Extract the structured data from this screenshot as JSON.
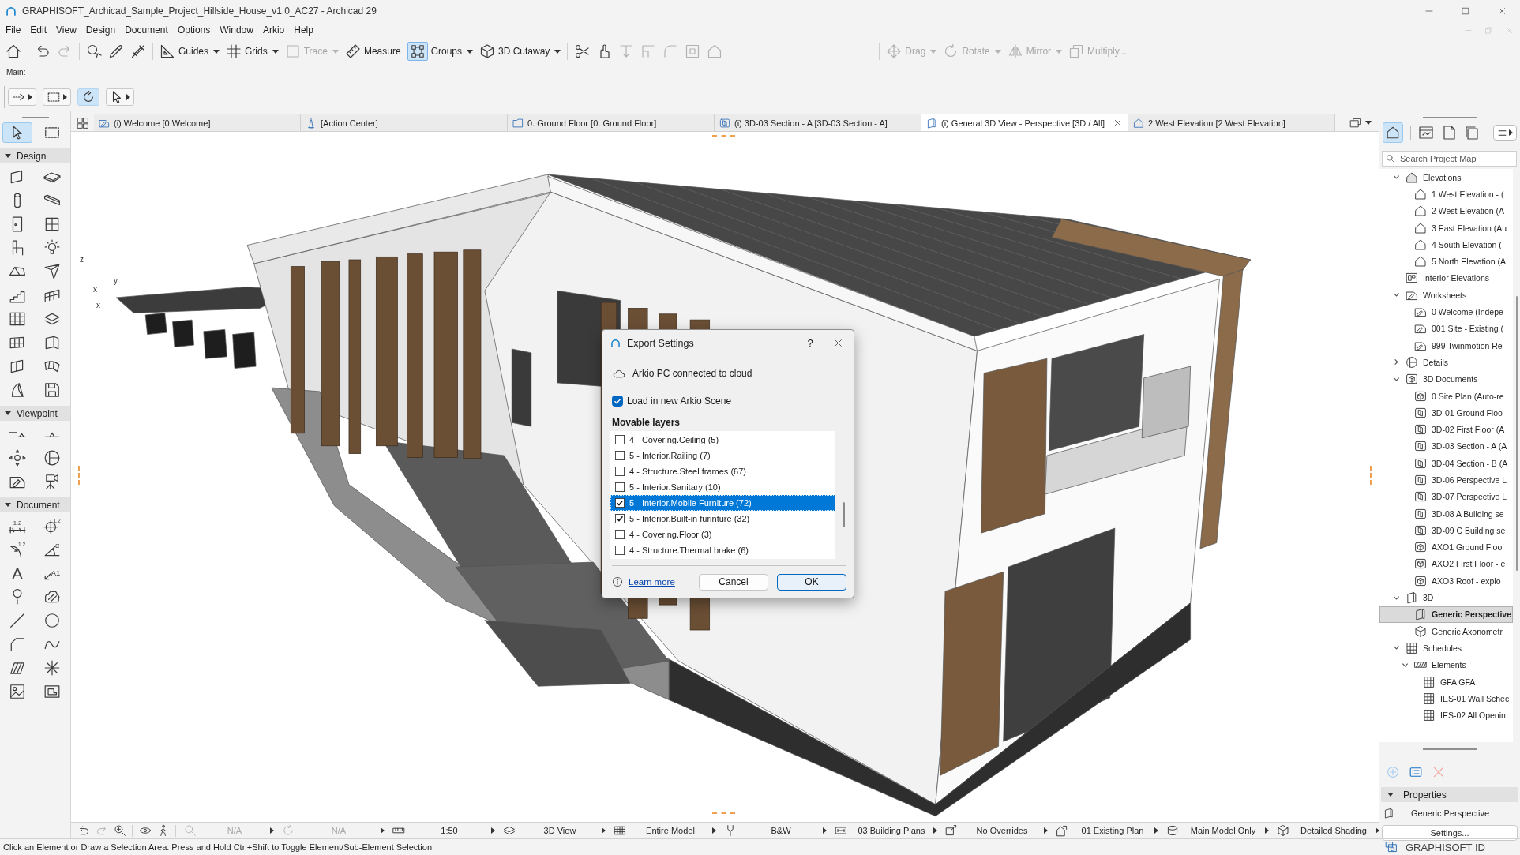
{
  "window": {
    "title": "GRAPHISOFT_Archicad_Sample_Project_Hillside_House_v1.0_AC27 - Archicad 29"
  },
  "menu_bar": {
    "items": [
      "File",
      "Edit",
      "View",
      "Design",
      "Document",
      "Options",
      "Window",
      "Arkio",
      "Help"
    ]
  },
  "toolbar": {
    "left": [
      [
        {
          "kind": "home",
          "disabled": false
        }
      ],
      [
        {
          "kind": "undo",
          "disabled": false
        },
        {
          "kind": "redo",
          "disabled": true
        }
      ],
      [
        {
          "kind": "find",
          "disabled": false
        },
        {
          "kind": "pick_up",
          "disabled": false
        },
        {
          "kind": "inject",
          "disabled": false
        }
      ],
      [
        {
          "kind": "guides",
          "label": "Guides",
          "disabled": false,
          "on": false,
          "menu": true
        },
        {
          "kind": "grids",
          "label": "Grids",
          "disabled": false,
          "on": false,
          "menu": true
        },
        {
          "kind": "trace",
          "label": "Trace",
          "disabled": true,
          "on": false,
          "menu": true
        },
        {
          "kind": "measure",
          "label": "Measure",
          "disabled": false,
          "on": false,
          "menu": false
        },
        {
          "kind": "groups",
          "label": "Groups",
          "disabled": false,
          "on": true,
          "menu": true
        },
        {
          "kind": "cutaway",
          "label": "3D Cutaway",
          "disabled": false,
          "on": false,
          "menu": true
        }
      ],
      [
        {
          "kind": "split",
          "disabled": false
        },
        {
          "kind": "adjust",
          "disabled": false
        },
        {
          "kind": "trim",
          "disabled": true
        },
        {
          "kind": "intersect",
          "disabled": true
        },
        {
          "kind": "fillet",
          "disabled": true
        },
        {
          "kind": "offset",
          "disabled": true
        },
        {
          "kind": "solid",
          "disabled": true
        }
      ]
    ],
    "right": [
      {
        "kind": "drag",
        "label": "Drag",
        "disabled": true,
        "on": false,
        "menu": true
      },
      {
        "kind": "rotate",
        "label": "Rotate",
        "disabled": true,
        "on": false,
        "menu": true
      },
      {
        "kind": "mirror",
        "label": "Mirror",
        "disabled": true,
        "on": false,
        "menu": true
      },
      {
        "kind": "multiply",
        "label": "Multiply...",
        "disabled": true,
        "on": false,
        "menu": false
      }
    ]
  },
  "info_box": {
    "label": "Main:",
    "tools": [
      {
        "kind": "dim_type",
        "selected": false,
        "menu": true
      },
      {
        "kind": "marquee",
        "selected": false,
        "menu": true
      },
      {
        "kind": "orbit",
        "selected": true,
        "menu": false
      },
      {
        "kind": "pointer",
        "selected": false,
        "menu": true
      }
    ]
  },
  "toolbox": {
    "pointer_tools": [
      {
        "kind": "pointer",
        "selected": true
      },
      {
        "kind": "marquee",
        "selected": false
      }
    ],
    "sections": [
      {
        "title": "Design",
        "expanded": true,
        "tools": [
          {
            "kind": "wall",
            "selected": false
          },
          {
            "kind": "slab",
            "selected": false
          },
          {
            "kind": "column",
            "selected": false
          },
          {
            "kind": "beam",
            "selected": false
          },
          {
            "kind": "door",
            "selected": false
          },
          {
            "kind": "window",
            "selected": false
          },
          {
            "kind": "object",
            "selected": false
          },
          {
            "kind": "lamp",
            "selected": false
          },
          {
            "kind": "roof",
            "selected": false
          },
          {
            "kind": "shell",
            "selected": false
          },
          {
            "kind": "stair",
            "selected": false
          },
          {
            "kind": "railing",
            "selected": false
          },
          {
            "kind": "curtain_wall",
            "selected": false
          },
          {
            "kind": "stacked",
            "selected": false
          },
          {
            "kind": "zone",
            "selected": false
          },
          {
            "kind": "corner_panel",
            "selected": false
          },
          {
            "kind": "skylight",
            "selected": false
          },
          {
            "kind": "mesh",
            "selected": false
          },
          {
            "kind": "morph",
            "selected": false
          },
          {
            "kind": "object_box",
            "selected": false
          }
        ]
      },
      {
        "title": "Viewpoint",
        "expanded": true,
        "tools": [
          {
            "kind": "section",
            "selected": false
          },
          {
            "kind": "elevation_marker",
            "selected": false
          },
          {
            "kind": "interior_elevation",
            "selected": false
          },
          {
            "kind": "detail",
            "selected": false
          },
          {
            "kind": "worksheet",
            "selected": false
          },
          {
            "kind": "camera",
            "selected": false
          }
        ]
      },
      {
        "title": "Document",
        "expanded": true,
        "tools": [
          {
            "kind": "dimension",
            "glyph": "1.2",
            "selected": false
          },
          {
            "kind": "level_dimension",
            "glyph": "1.2",
            "selected": false
          },
          {
            "kind": "radial_dimension",
            "glyph": "1.2",
            "selected": false
          },
          {
            "kind": "angle_dimension",
            "glyph": "α",
            "selected": false
          },
          {
            "kind": "text",
            "glyph": "A",
            "selected": false
          },
          {
            "kind": "label",
            "glyph": "A1",
            "selected": false
          },
          {
            "kind": "marker",
            "selected": false
          },
          {
            "kind": "revision",
            "selected": false
          },
          {
            "kind": "line",
            "selected": false
          },
          {
            "kind": "circle",
            "selected": false
          },
          {
            "kind": "polyline",
            "selected": false
          },
          {
            "kind": "spline",
            "selected": false
          },
          {
            "kind": "fill",
            "selected": false
          },
          {
            "kind": "hotspot",
            "selected": false
          },
          {
            "kind": "figure",
            "selected": false
          },
          {
            "kind": "drawing",
            "selected": false
          }
        ]
      }
    ]
  },
  "tabs": {
    "items": [
      {
        "kind": "worksheet",
        "label": "(i) Welcome [0 Welcome]",
        "selected": false
      },
      {
        "kind": "action_center",
        "label": "[Action Center]",
        "selected": false
      },
      {
        "kind": "floor_plan",
        "label": "0. Ground Floor [0. Ground Floor]",
        "selected": false
      },
      {
        "kind": "section_3d",
        "label": "(i) 3D-03 Section - A [3D-03 Section - A]",
        "selected": false
      },
      {
        "kind": "perspective",
        "label": "(i) General 3D View - Perspective [3D / All]",
        "selected": true
      },
      {
        "kind": "elevation",
        "label": "2 West Elevation [2 West Elevation]",
        "selected": false
      }
    ]
  },
  "viewport": {
    "axis_labels": [
      "z",
      "x",
      "y",
      "x"
    ]
  },
  "dialog": {
    "title": "Export Settings",
    "help": "?",
    "connection": "Arkio PC connected to cloud",
    "load_scene": {
      "label": "Load in new Arkio Scene",
      "checked": true
    },
    "layers_heading": "Movable layers",
    "layers": [
      {
        "name": "4 - Covering.Ceiling (5)",
        "checked": false,
        "selected": false
      },
      {
        "name": "5 - Interior.Railing (7)",
        "checked": false,
        "selected": false
      },
      {
        "name": "4 - Structure.Steel frames (67)",
        "checked": false,
        "selected": false
      },
      {
        "name": "5 - Interior.Sanitary (10)",
        "checked": false,
        "selected": false
      },
      {
        "name": "5 - Interior.Mobile Furniture (72)",
        "checked": true,
        "selected": true
      },
      {
        "name": "5 - Interior.Built-in furinture (32)",
        "checked": true,
        "selected": false
      },
      {
        "name": "4 - Covering.Floor (3)",
        "checked": false,
        "selected": false
      },
      {
        "name": "4 - Structure.Thermal brake (6)",
        "checked": false,
        "selected": false
      }
    ],
    "link": "Learn more",
    "buttons": [
      {
        "label": "Cancel",
        "default": false
      },
      {
        "label": "OK",
        "default": true
      }
    ]
  },
  "navigator": {
    "views": [
      {
        "kind": "project_map",
        "selected": true
      },
      {
        "kind": "view_map",
        "selected": false
      },
      {
        "kind": "layout_book",
        "selected": false
      },
      {
        "kind": "publisher",
        "selected": false
      }
    ],
    "search": {
      "placeholder": "Search Project Map"
    },
    "tree": [
      {
        "kind": "elevations",
        "label": "Elevations",
        "expanded": true,
        "selected": false,
        "children": [
          {
            "kind": "elevation",
            "label": "1 West Elevation - (",
            "selected": false
          },
          {
            "kind": "elevation",
            "label": "2 West Elevation (A",
            "selected": false
          },
          {
            "kind": "elevation",
            "label": "3 East Elevation (Au",
            "selected": false
          },
          {
            "kind": "elevation",
            "label": "4 South Elevation (",
            "selected": false
          },
          {
            "kind": "elevation",
            "label": "5 North Elevation (A",
            "selected": false
          }
        ]
      },
      {
        "kind": "interior_elevations",
        "label": "Interior Elevations",
        "selected": false
      },
      {
        "kind": "worksheet",
        "label": "Worksheets",
        "expanded": true,
        "selected": false,
        "children": [
          {
            "kind": "worksheet",
            "label": "0 Welcome (Indepe",
            "selected": false
          },
          {
            "kind": "worksheet",
            "label": "001 Site - Existing (",
            "selected": false
          },
          {
            "kind": "worksheet",
            "label": "999 Twinmotion Re",
            "selected": false
          }
        ]
      },
      {
        "kind": "detail",
        "label": "Details",
        "expanded": false,
        "selected": false
      },
      {
        "kind": "documents_3d",
        "label": "3D Documents",
        "expanded": true,
        "selected": false,
        "children": [
          {
            "kind": "documents_3d",
            "label": "0 Site Plan (Auto-re",
            "selected": false
          },
          {
            "kind": "section_doc",
            "label": "3D-01 Ground Floo",
            "selected": false
          },
          {
            "kind": "section_doc",
            "label": "3D-02 First Floor (A",
            "selected": false
          },
          {
            "kind": "section_doc",
            "label": "3D-03 Section - A (A",
            "selected": false
          },
          {
            "kind": "section_doc",
            "label": "3D-04 Section - B (A",
            "selected": false
          },
          {
            "kind": "section_doc",
            "label": "3D-06 Perspective L",
            "selected": false
          },
          {
            "kind": "section_doc",
            "label": "3D-07 Perspective L",
            "selected": false
          },
          {
            "kind": "section_doc",
            "label": "3D-08 A Building se",
            "selected": false
          },
          {
            "kind": "section_doc",
            "label": "3D-09 C Building se",
            "selected": false
          },
          {
            "kind": "documents_3d",
            "label": "AXO1 Ground Floo",
            "selected": false
          },
          {
            "kind": "documents_3d",
            "label": "AXO2 First Floor - e",
            "selected": false
          },
          {
            "kind": "documents_3d",
            "label": "AXO3 Roof - explo",
            "selected": false
          }
        ]
      },
      {
        "kind": "perspective",
        "label": "3D",
        "expanded": true,
        "selected": false,
        "children": [
          {
            "kind": "perspective",
            "label": "Generic Perspective",
            "selected": true
          },
          {
            "kind": "axonometry",
            "label": "Generic Axonometr",
            "selected": false
          }
        ]
      },
      {
        "kind": "schedules",
        "label": "Schedules",
        "expanded": true,
        "selected": false,
        "children": [
          {
            "kind": "elements",
            "label": "Elements",
            "expanded": true,
            "selected": false,
            "children": [
              {
                "kind": "schedules",
                "label": "GFA GFA",
                "selected": false
              },
              {
                "kind": "schedules",
                "label": "IES-01 Wall Schec",
                "selected": false
              },
              {
                "kind": "schedules",
                "label": "IES-02 All Openin",
                "selected": false
              }
            ]
          }
        ]
      }
    ]
  },
  "properties": {
    "actions": [
      {
        "kind": "add",
        "disabled": true
      },
      {
        "kind": "list",
        "disabled": false
      },
      {
        "kind": "delete",
        "disabled": true
      }
    ],
    "title": "Properties",
    "expanded": true,
    "item": "Generic Perspective",
    "button": "Settings..."
  },
  "view_bar": {
    "buttons": [
      {
        "kind": "back",
        "disabled": false
      },
      {
        "kind": "forward",
        "disabled": true
      },
      {
        "kind": "zoom_in",
        "disabled": false
      },
      {
        "kind": "orbit_view",
        "disabled": false
      },
      {
        "kind": "walk",
        "disabled": false
      }
    ],
    "selectors": [
      {
        "kind": "zoom",
        "label": "N/A",
        "disabled": true
      },
      {
        "kind": "rotation",
        "label": "N/A",
        "disabled": true
      },
      {
        "kind": "scale",
        "label": "1:50",
        "disabled": false
      },
      {
        "kind": "layers",
        "label": "3D View",
        "disabled": false
      },
      {
        "kind": "model_view",
        "label": "Entire Model",
        "disabled": false
      },
      {
        "kind": "pen_set",
        "label": "B&W",
        "disabled": false
      },
      {
        "kind": "dimensions",
        "label": "03 Building Plans",
        "disabled": false
      },
      {
        "kind": "overrides",
        "label": "No Overrides",
        "disabled": false
      },
      {
        "kind": "renovation",
        "label": "01 Existing Plan",
        "disabled": false
      },
      {
        "kind": "structure",
        "label": "Main Model Only",
        "disabled": false
      },
      {
        "kind": "shading",
        "label": "Detailed Shading",
        "disabled": false
      }
    ]
  },
  "status_bar": {
    "message": "Click an Element or Draw a Selection Area. Press and Hold Ctrl+Shift to Toggle Element/Sub-Element Selection.",
    "account": "GRAPHISOFT ID"
  }
}
